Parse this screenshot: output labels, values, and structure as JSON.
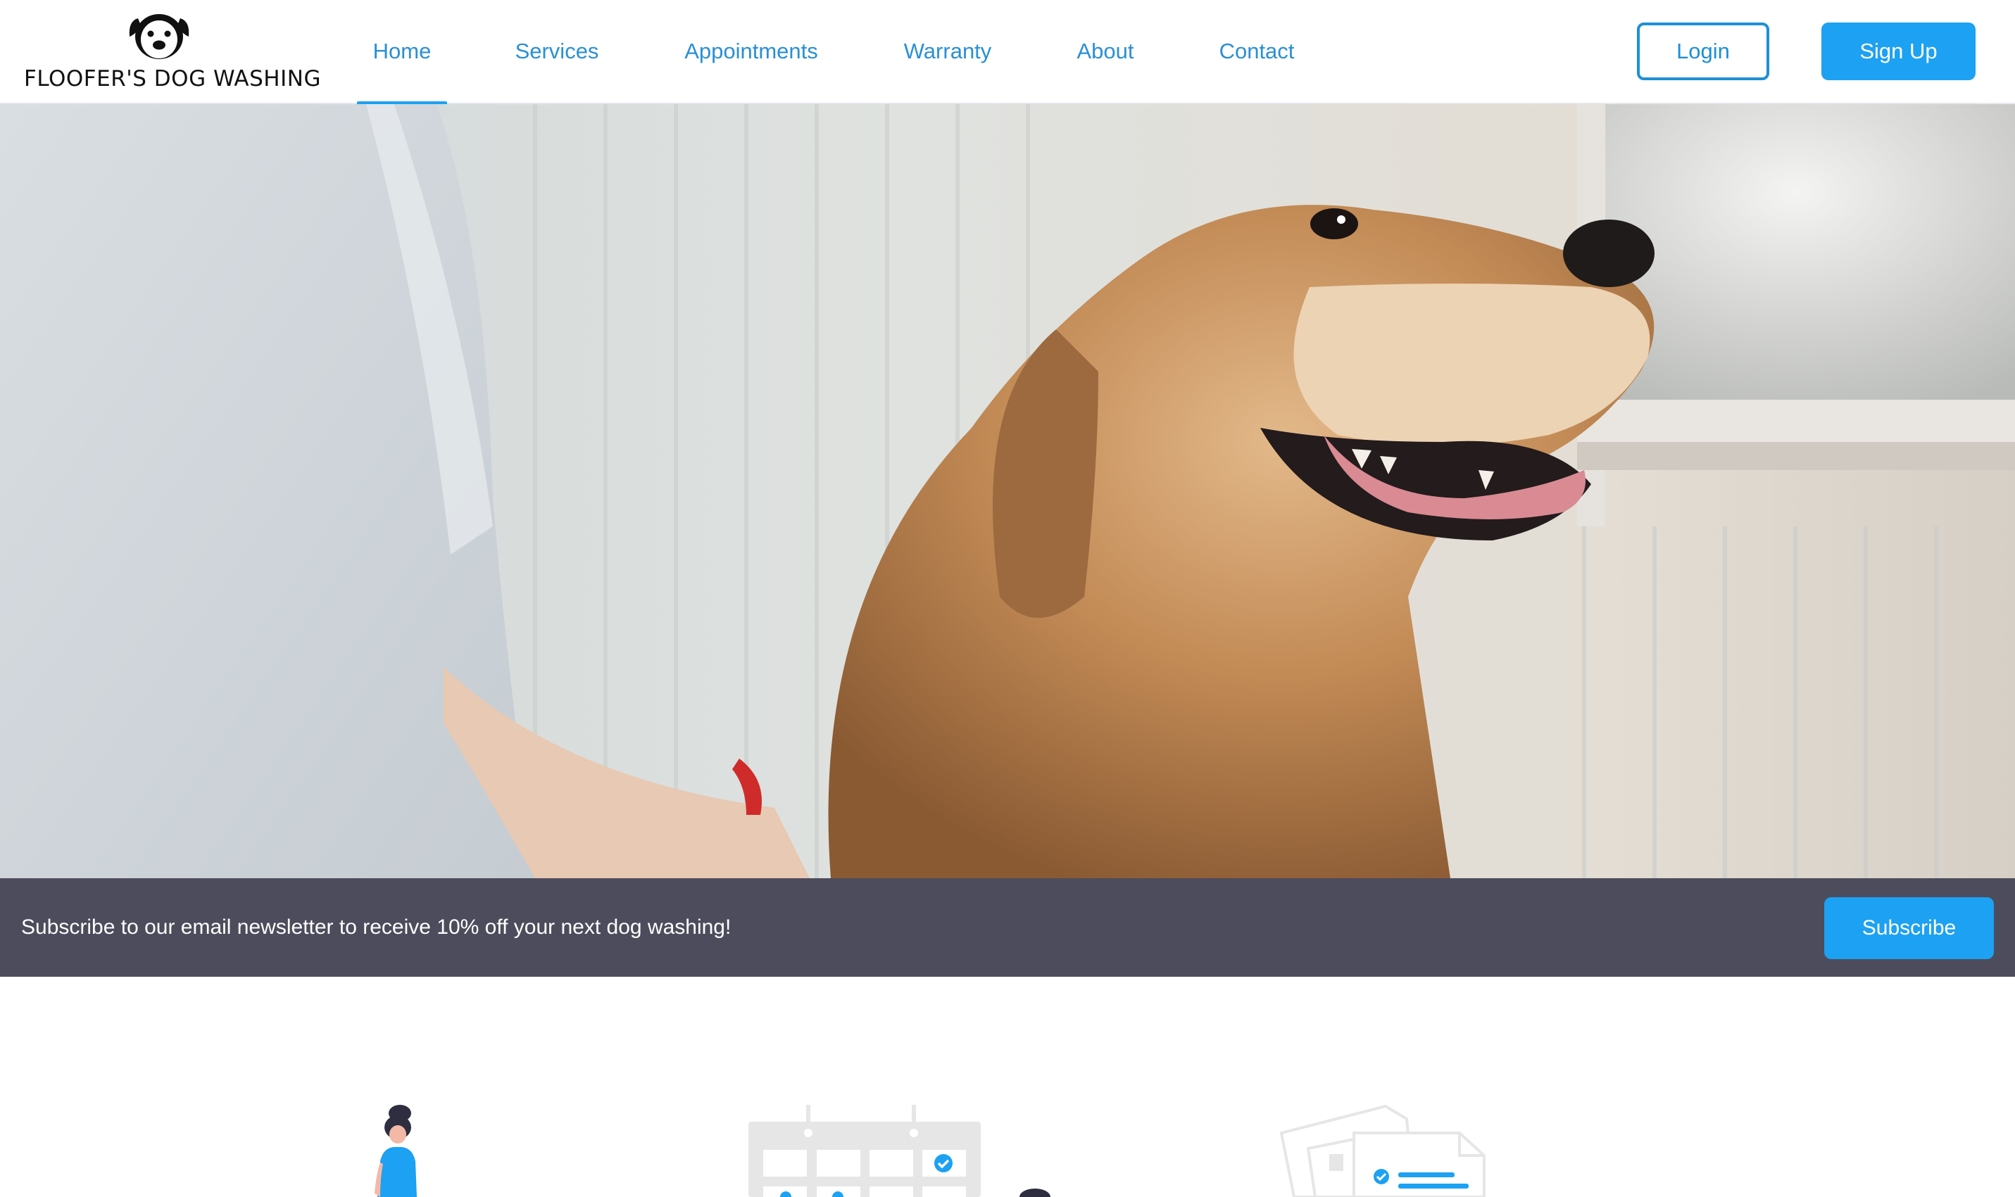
{
  "brand": {
    "name": "FLOOFER'S DOG WASHING",
    "logo_icon": "dog-face-icon"
  },
  "nav": {
    "items": [
      {
        "label": "Home",
        "active": true
      },
      {
        "label": "Services",
        "active": false
      },
      {
        "label": "Appointments",
        "active": false
      },
      {
        "label": "Warranty",
        "active": false
      },
      {
        "label": "About",
        "active": false
      },
      {
        "label": "Contact",
        "active": false
      }
    ]
  },
  "auth": {
    "login_label": "Login",
    "signup_label": "Sign Up"
  },
  "newsletter": {
    "text": "Subscribe to our email newsletter to receive 10% off your next dog washing!",
    "button_label": "Subscribe"
  },
  "colors": {
    "accent": "#1da1f2",
    "nav_text": "#2a8fd6",
    "newsletter_bg": "#4d4c5c"
  },
  "illustrations": [
    "person-illustration",
    "calendar-illustration",
    "documents-illustration"
  ]
}
